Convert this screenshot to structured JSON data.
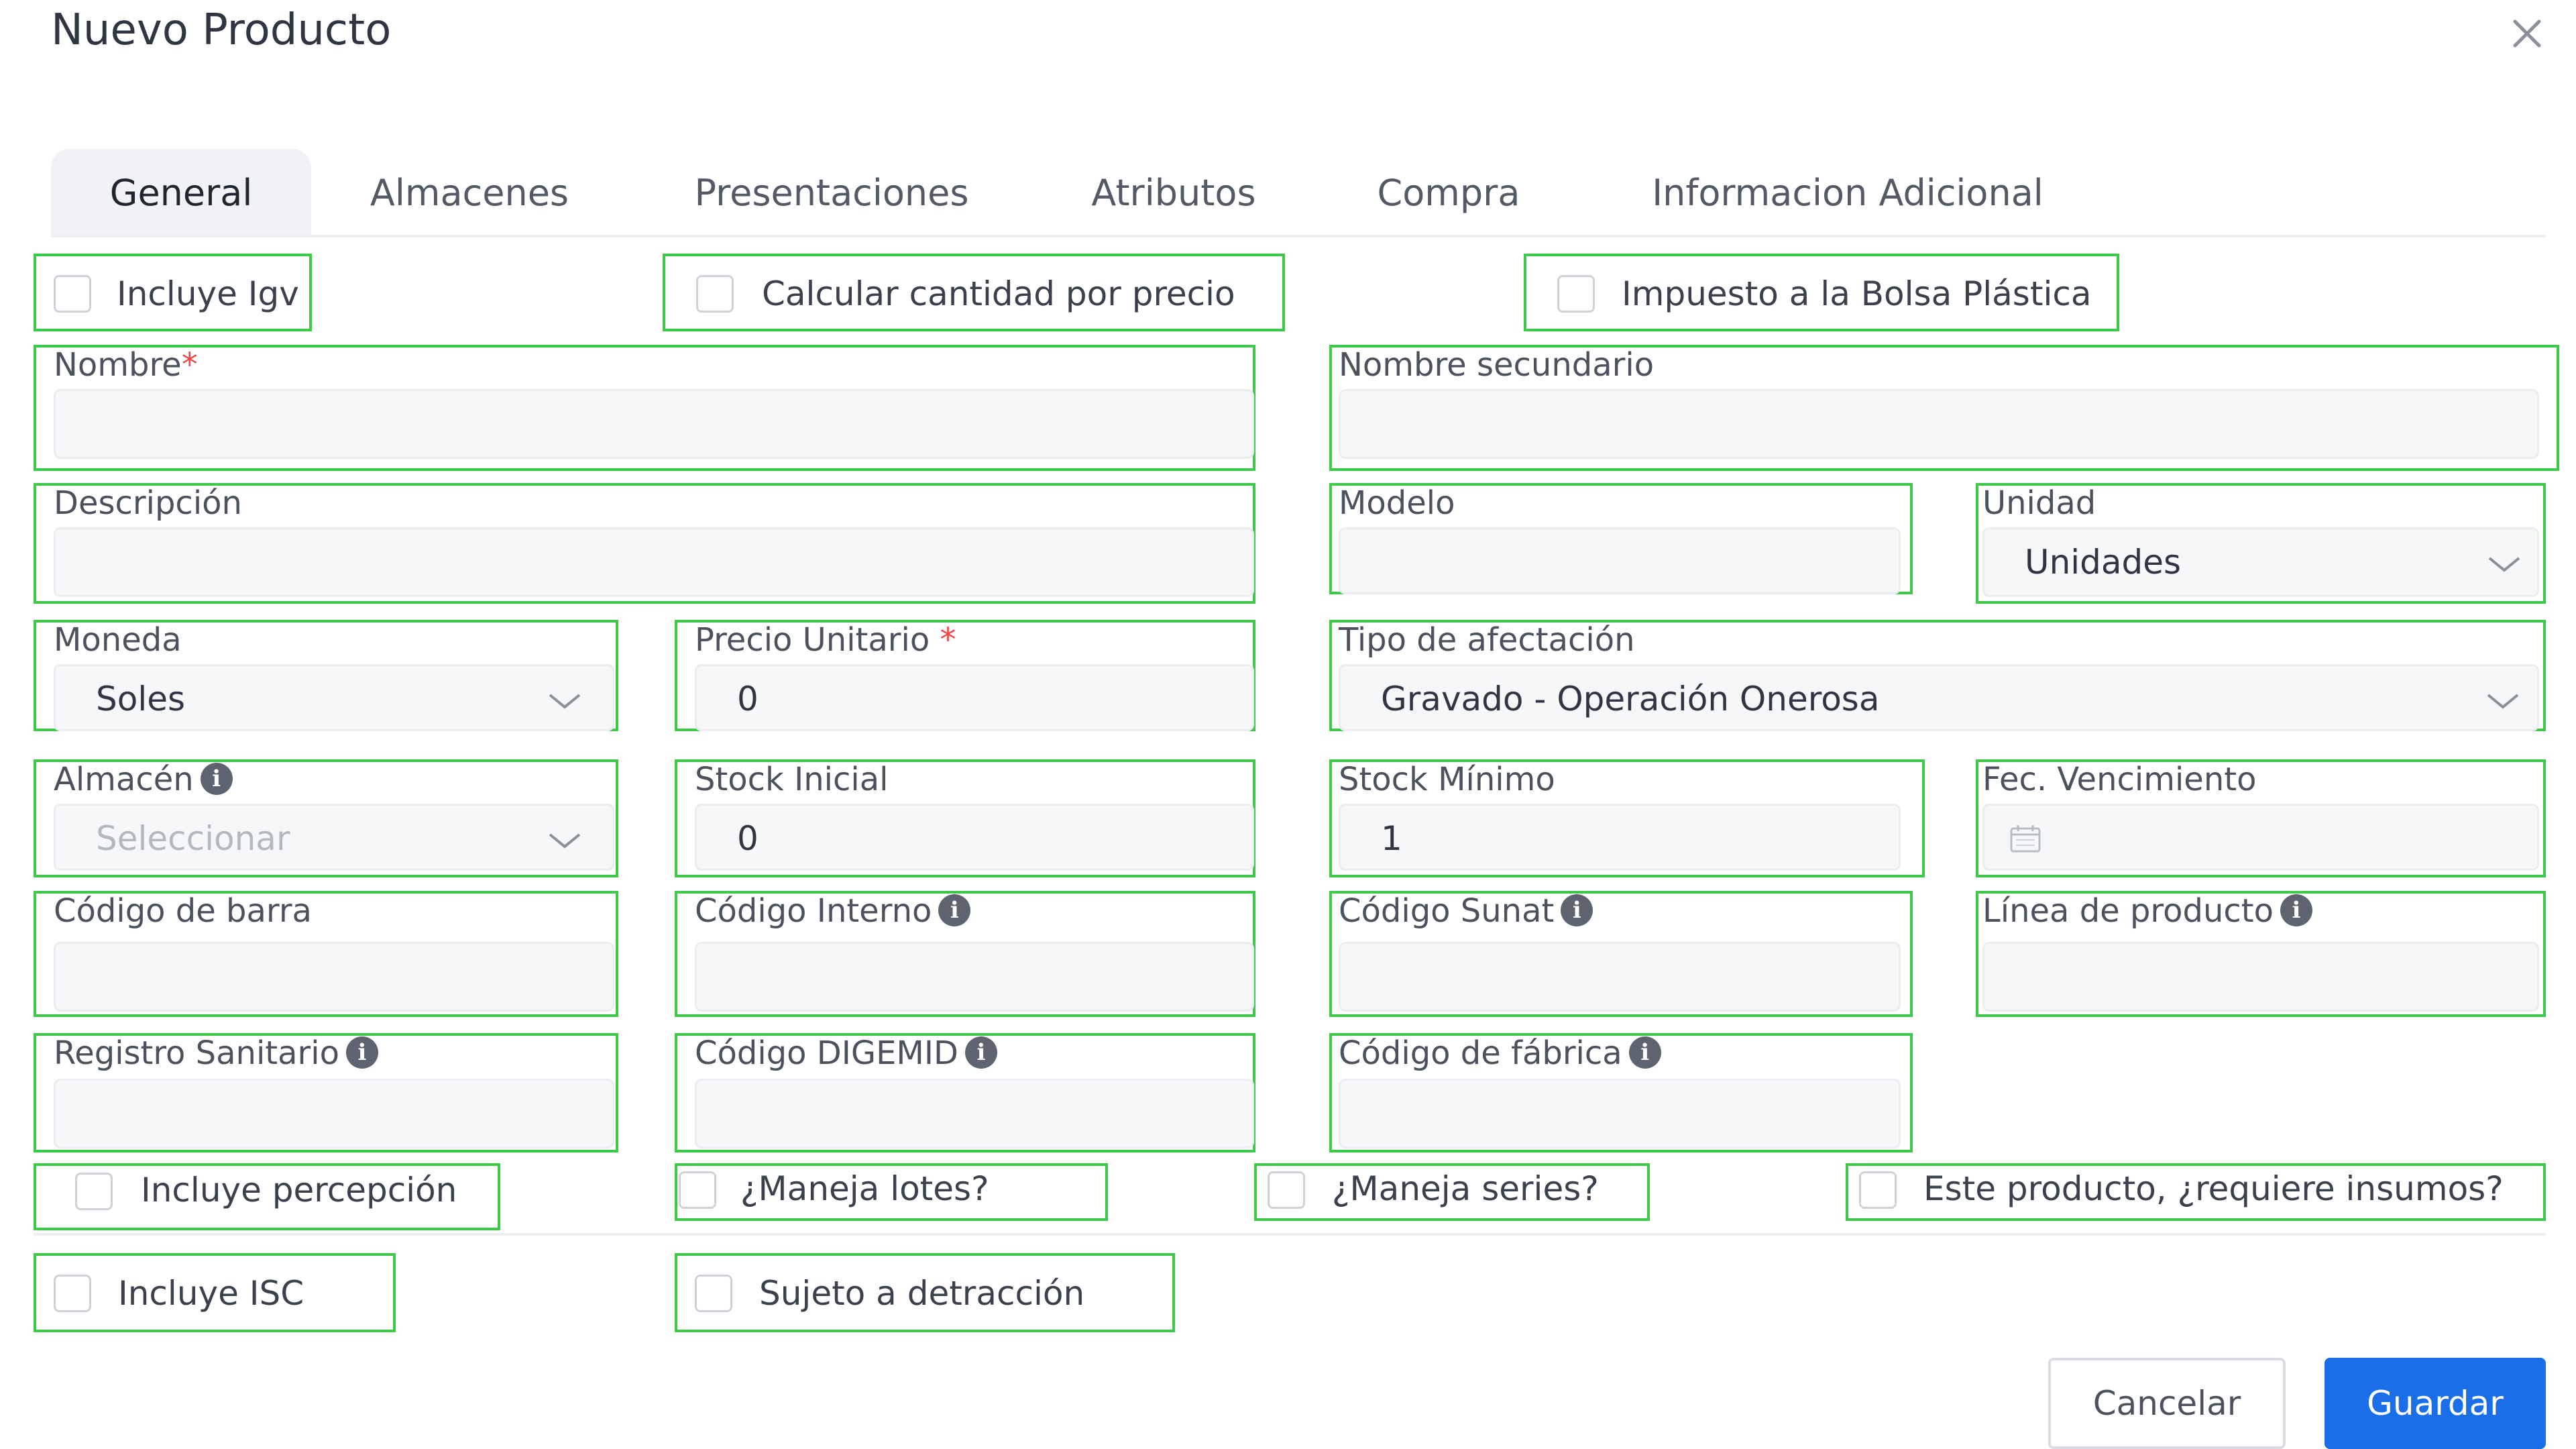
{
  "dialog": {
    "title": "Nuevo Producto"
  },
  "tabs": [
    {
      "label": "General",
      "active": true
    },
    {
      "label": "Almacenes",
      "active": false
    },
    {
      "label": "Presentaciones",
      "active": false
    },
    {
      "label": "Atributos",
      "active": false
    },
    {
      "label": "Compra",
      "active": false
    },
    {
      "label": "Informacion Adicional",
      "active": false
    }
  ],
  "checkboxes": {
    "incluye_igv": {
      "label": "Incluye Igv",
      "checked": false
    },
    "calcular_cantidad": {
      "label": "Calcular cantidad por precio",
      "checked": false
    },
    "impuesto_bolsa": {
      "label": "Impuesto a la Bolsa Plástica",
      "checked": false
    },
    "incluye_percepcion": {
      "label": "Incluye percepción",
      "checked": false
    },
    "maneja_lotes": {
      "label": "¿Maneja lotes?",
      "checked": false
    },
    "maneja_series": {
      "label": "¿Maneja series?",
      "checked": false
    },
    "requiere_insumos": {
      "label": "Este producto, ¿requiere insumos?",
      "checked": false
    },
    "incluye_isc": {
      "label": "Incluye ISC",
      "checked": false
    },
    "sujeto_detraccion": {
      "label": "Sujeto a detracción",
      "checked": false
    }
  },
  "fields": {
    "nombre": {
      "label": "Nombre",
      "required_mark": "*",
      "value": ""
    },
    "nombre_secundario": {
      "label": "Nombre secundario",
      "value": ""
    },
    "descripcion": {
      "label": "Descripción",
      "value": ""
    },
    "modelo": {
      "label": "Modelo",
      "value": ""
    },
    "unidad": {
      "label": "Unidad",
      "value": "Unidades"
    },
    "moneda": {
      "label": "Moneda",
      "value": "Soles"
    },
    "precio_unitario": {
      "label": "Precio Unitario ",
      "required_mark": "*",
      "value": "0"
    },
    "tipo_afectacion": {
      "label": "Tipo de afectación",
      "value": "Gravado - Operación Onerosa"
    },
    "almacen": {
      "label": "Almacén",
      "placeholder": "Seleccionar"
    },
    "stock_inicial": {
      "label": "Stock Inicial",
      "value": "0"
    },
    "stock_minimo": {
      "label": "Stock Mínimo",
      "value": "1"
    },
    "fec_vencimiento": {
      "label": "Fec. Vencimiento",
      "value": ""
    },
    "codigo_barra": {
      "label": "Código de barra",
      "value": ""
    },
    "codigo_interno": {
      "label": "Código Interno",
      "value": ""
    },
    "codigo_sunat": {
      "label": "Código Sunat",
      "value": ""
    },
    "linea_producto": {
      "label": "Línea de producto",
      "value": ""
    },
    "registro_sanitario": {
      "label": "Registro Sanitario",
      "value": ""
    },
    "codigo_digemid": {
      "label": "Código DIGEMID",
      "value": ""
    },
    "codigo_fabrica": {
      "label": "Código de fábrica",
      "value": ""
    }
  },
  "buttons": {
    "cancel": "Cancelar",
    "save": "Guardar"
  },
  "icons": {
    "info": "i"
  },
  "colors": {
    "primary": "#1a6ee8",
    "outline": "#3ec94a",
    "required": "#f04848"
  }
}
